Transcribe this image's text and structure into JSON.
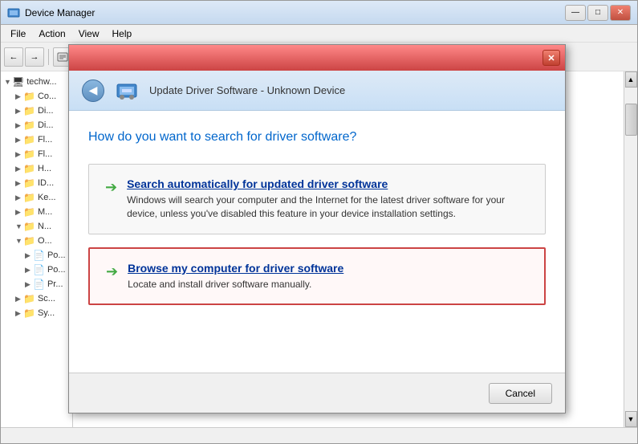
{
  "window": {
    "title": "Device Manager",
    "controls": {
      "minimize": "—",
      "maximize": "□",
      "close": "✕"
    }
  },
  "menubar": {
    "items": [
      "File",
      "Action",
      "View",
      "Help"
    ]
  },
  "toolbar": {
    "buttons": [
      "←",
      "→",
      "☰",
      "|",
      "?",
      "☐",
      "⊡",
      "|",
      "⊙",
      "⊗",
      "⊕",
      "⊞",
      "|",
      "⊟"
    ]
  },
  "tree": {
    "items": [
      {
        "label": "techw...",
        "indent": 0,
        "expanded": true
      },
      {
        "label": "Co...",
        "indent": 1
      },
      {
        "label": "Di...",
        "indent": 1
      },
      {
        "label": "Di...",
        "indent": 1
      },
      {
        "label": "Fl...",
        "indent": 1
      },
      {
        "label": "Fl...",
        "indent": 1
      },
      {
        "label": "H...",
        "indent": 1
      },
      {
        "label": "ID...",
        "indent": 1
      },
      {
        "label": "Ke...",
        "indent": 1
      },
      {
        "label": "M...",
        "indent": 1
      },
      {
        "label": "N...",
        "indent": 1,
        "expanded": true
      },
      {
        "label": "O...",
        "indent": 1,
        "expanded": true
      },
      {
        "label": "P...",
        "indent": 2
      },
      {
        "label": "P...",
        "indent": 2
      },
      {
        "label": "Pr...",
        "indent": 2
      },
      {
        "label": "Sc...",
        "indent": 1
      },
      {
        "label": "Sy...",
        "indent": 1
      }
    ]
  },
  "modal": {
    "title_text": "Update Driver Software - Unknown Device",
    "close_btn": "✕",
    "header": {
      "back_arrow": "◀",
      "title": "Update Driver Software - Unknown Device"
    },
    "question": "How do you want to search for driver software?",
    "options": [
      {
        "id": "auto",
        "arrow": "➔",
        "title": "Search automatically for updated driver software",
        "description": "Windows will search your computer and the Internet for the latest driver software for your device, unless you've disabled this feature in your device installation settings."
      },
      {
        "id": "browse",
        "arrow": "➔",
        "title": "Browse my computer for driver software",
        "description": "Locate and install driver software manually."
      }
    ],
    "footer": {
      "cancel_label": "Cancel"
    }
  }
}
